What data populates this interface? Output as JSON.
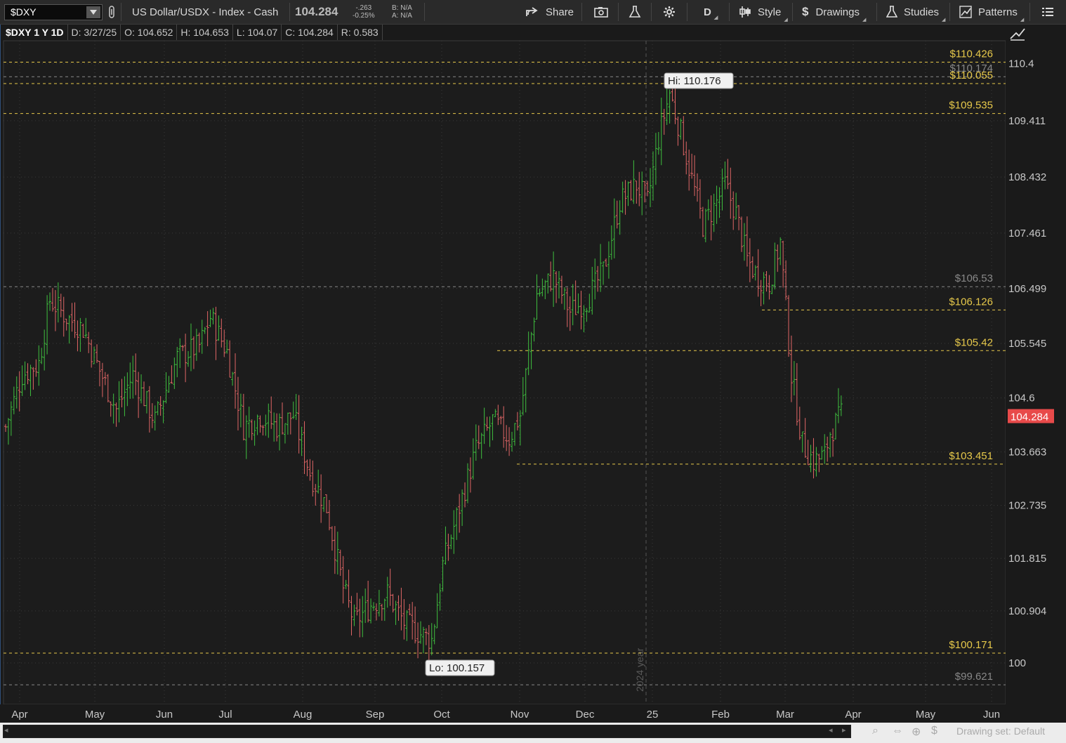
{
  "toolbar": {
    "symbol": "$DXY",
    "description": "US Dollar/USDX - Index - Cash",
    "last": "104.284",
    "change": "-.263",
    "change_pct": "-0.25%",
    "bid": "B: N/A",
    "ask": "A: N/A",
    "share": "Share",
    "aggregation": "D",
    "style": "Style",
    "drawings": "Drawings",
    "studies": "Studies",
    "patterns": "Patterns"
  },
  "infobar": {
    "symbol_period": "$DXY 1 Y 1D",
    "date": "D: 3/27/25",
    "open": "O: 104.652",
    "high": "H: 104.653",
    "low": "L: 104.07",
    "close": "C: 104.284",
    "range": "R: 0.583"
  },
  "chart_data": {
    "type": "ohlc",
    "y_ticks": [
      "110.4",
      "109.411",
      "108.432",
      "107.461",
      "106.499",
      "105.545",
      "104.6",
      "103.663",
      "102.735",
      "101.815",
      "100.904",
      "100"
    ],
    "x_ticks": [
      "Apr",
      "May",
      "Jun",
      "Jul",
      "Aug",
      "Sep",
      "Oct",
      "Nov",
      "Dec",
      "25",
      "Feb",
      "Mar",
      "Apr",
      "May",
      "Jun"
    ],
    "last_price": "104.284",
    "last_price_color": "#e84a4a",
    "up_color": "#3fbf3f",
    "down_color": "#e06666",
    "hi_bubble": "Hi: 110.176",
    "lo_bubble": "Lo: 100.157",
    "year_marker": "2024 year",
    "levels": [
      {
        "label": "$110.426",
        "value": 110.426,
        "color": "#e6c84a"
      },
      {
        "label": "$110.174",
        "value": 110.174,
        "color": "#888888"
      },
      {
        "label": "$110.055",
        "value": 110.055,
        "color": "#e6c84a"
      },
      {
        "label": "$109.535",
        "value": 109.535,
        "color": "#e6c84a"
      },
      {
        "label": "$106.53",
        "value": 106.53,
        "color": "#888888"
      },
      {
        "label": "$106.126",
        "value": 106.126,
        "color": "#e6c84a"
      },
      {
        "label": "$105.42",
        "value": 105.42,
        "color": "#e6c84a"
      },
      {
        "label": "$103.451",
        "value": 103.451,
        "color": "#e6c84a"
      },
      {
        "label": "$100.171",
        "value": 100.171,
        "color": "#e6c84a"
      },
      {
        "label": "$99.621",
        "value": 99.621,
        "color": "#888888"
      }
    ],
    "anchors": [
      {
        "bar": 0,
        "v": 104.1
      },
      {
        "bar": 6,
        "v": 105.0
      },
      {
        "bar": 12,
        "v": 105.2
      },
      {
        "bar": 16,
        "v": 106.3
      },
      {
        "bar": 22,
        "v": 106.0
      },
      {
        "bar": 28,
        "v": 105.8
      },
      {
        "bar": 32,
        "v": 105.3
      },
      {
        "bar": 40,
        "v": 104.4
      },
      {
        "bar": 46,
        "v": 105.0
      },
      {
        "bar": 54,
        "v": 104.2
      },
      {
        "bar": 62,
        "v": 105.3
      },
      {
        "bar": 70,
        "v": 105.5
      },
      {
        "bar": 74,
        "v": 106.0
      },
      {
        "bar": 80,
        "v": 105.4
      },
      {
        "bar": 86,
        "v": 104.1
      },
      {
        "bar": 92,
        "v": 104.3
      },
      {
        "bar": 98,
        "v": 104.1
      },
      {
        "bar": 104,
        "v": 104.3
      },
      {
        "bar": 110,
        "v": 103.3
      },
      {
        "bar": 116,
        "v": 102.7
      },
      {
        "bar": 122,
        "v": 101.3
      },
      {
        "bar": 126,
        "v": 100.7
      },
      {
        "bar": 132,
        "v": 101.0
      },
      {
        "bar": 138,
        "v": 101.2
      },
      {
        "bar": 144,
        "v": 100.7
      },
      {
        "bar": 150,
        "v": 100.5
      },
      {
        "bar": 154,
        "v": 100.4
      },
      {
        "bar": 158,
        "v": 101.7
      },
      {
        "bar": 164,
        "v": 102.7
      },
      {
        "bar": 170,
        "v": 103.7
      },
      {
        "bar": 176,
        "v": 104.2
      },
      {
        "bar": 182,
        "v": 103.9
      },
      {
        "bar": 186,
        "v": 104.3
      },
      {
        "bar": 192,
        "v": 106.4
      },
      {
        "bar": 198,
        "v": 106.7
      },
      {
        "bar": 204,
        "v": 106.1
      },
      {
        "bar": 210,
        "v": 106.3
      },
      {
        "bar": 216,
        "v": 106.8
      },
      {
        "bar": 222,
        "v": 108.0
      },
      {
        "bar": 228,
        "v": 108.3
      },
      {
        "bar": 232,
        "v": 108.0
      },
      {
        "bar": 236,
        "v": 109.1
      },
      {
        "bar": 240,
        "v": 109.9
      },
      {
        "bar": 244,
        "v": 109.2
      },
      {
        "bar": 248,
        "v": 108.4
      },
      {
        "bar": 252,
        "v": 107.6
      },
      {
        "bar": 256,
        "v": 107.9
      },
      {
        "bar": 260,
        "v": 108.3
      },
      {
        "bar": 264,
        "v": 107.8
      },
      {
        "bar": 268,
        "v": 107.0
      },
      {
        "bar": 272,
        "v": 106.7
      },
      {
        "bar": 276,
        "v": 106.6
      },
      {
        "bar": 280,
        "v": 107.3
      },
      {
        "bar": 284,
        "v": 105.0
      },
      {
        "bar": 288,
        "v": 103.8
      },
      {
        "bar": 292,
        "v": 103.5
      },
      {
        "bar": 296,
        "v": 103.6
      },
      {
        "bar": 298,
        "v": 104.0
      },
      {
        "bar": 302,
        "v": 104.3
      }
    ]
  },
  "bottom": {
    "drawing_set": "Drawing set: Default"
  }
}
